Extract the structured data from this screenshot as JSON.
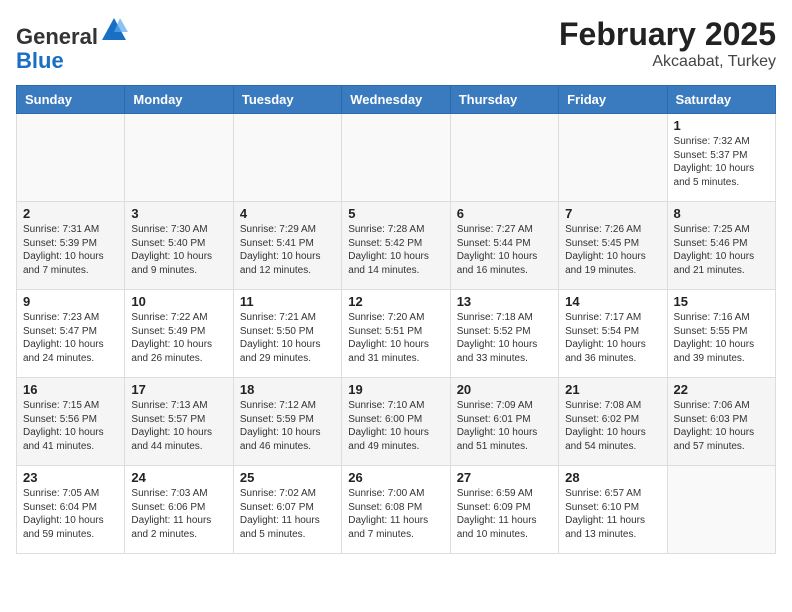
{
  "logo": {
    "general": "General",
    "blue": "Blue"
  },
  "title": "February 2025",
  "subtitle": "Akcaabat, Turkey",
  "days_of_week": [
    "Sunday",
    "Monday",
    "Tuesday",
    "Wednesday",
    "Thursday",
    "Friday",
    "Saturday"
  ],
  "weeks": [
    [
      {
        "day": "",
        "info": ""
      },
      {
        "day": "",
        "info": ""
      },
      {
        "day": "",
        "info": ""
      },
      {
        "day": "",
        "info": ""
      },
      {
        "day": "",
        "info": ""
      },
      {
        "day": "",
        "info": ""
      },
      {
        "day": "1",
        "info": "Sunrise: 7:32 AM\nSunset: 5:37 PM\nDaylight: 10 hours and 5 minutes."
      }
    ],
    [
      {
        "day": "2",
        "info": "Sunrise: 7:31 AM\nSunset: 5:39 PM\nDaylight: 10 hours and 7 minutes."
      },
      {
        "day": "3",
        "info": "Sunrise: 7:30 AM\nSunset: 5:40 PM\nDaylight: 10 hours and 9 minutes."
      },
      {
        "day": "4",
        "info": "Sunrise: 7:29 AM\nSunset: 5:41 PM\nDaylight: 10 hours and 12 minutes."
      },
      {
        "day": "5",
        "info": "Sunrise: 7:28 AM\nSunset: 5:42 PM\nDaylight: 10 hours and 14 minutes."
      },
      {
        "day": "6",
        "info": "Sunrise: 7:27 AM\nSunset: 5:44 PM\nDaylight: 10 hours and 16 minutes."
      },
      {
        "day": "7",
        "info": "Sunrise: 7:26 AM\nSunset: 5:45 PM\nDaylight: 10 hours and 19 minutes."
      },
      {
        "day": "8",
        "info": "Sunrise: 7:25 AM\nSunset: 5:46 PM\nDaylight: 10 hours and 21 minutes."
      }
    ],
    [
      {
        "day": "9",
        "info": "Sunrise: 7:23 AM\nSunset: 5:47 PM\nDaylight: 10 hours and 24 minutes."
      },
      {
        "day": "10",
        "info": "Sunrise: 7:22 AM\nSunset: 5:49 PM\nDaylight: 10 hours and 26 minutes."
      },
      {
        "day": "11",
        "info": "Sunrise: 7:21 AM\nSunset: 5:50 PM\nDaylight: 10 hours and 29 minutes."
      },
      {
        "day": "12",
        "info": "Sunrise: 7:20 AM\nSunset: 5:51 PM\nDaylight: 10 hours and 31 minutes."
      },
      {
        "day": "13",
        "info": "Sunrise: 7:18 AM\nSunset: 5:52 PM\nDaylight: 10 hours and 33 minutes."
      },
      {
        "day": "14",
        "info": "Sunrise: 7:17 AM\nSunset: 5:54 PM\nDaylight: 10 hours and 36 minutes."
      },
      {
        "day": "15",
        "info": "Sunrise: 7:16 AM\nSunset: 5:55 PM\nDaylight: 10 hours and 39 minutes."
      }
    ],
    [
      {
        "day": "16",
        "info": "Sunrise: 7:15 AM\nSunset: 5:56 PM\nDaylight: 10 hours and 41 minutes."
      },
      {
        "day": "17",
        "info": "Sunrise: 7:13 AM\nSunset: 5:57 PM\nDaylight: 10 hours and 44 minutes."
      },
      {
        "day": "18",
        "info": "Sunrise: 7:12 AM\nSunset: 5:59 PM\nDaylight: 10 hours and 46 minutes."
      },
      {
        "day": "19",
        "info": "Sunrise: 7:10 AM\nSunset: 6:00 PM\nDaylight: 10 hours and 49 minutes."
      },
      {
        "day": "20",
        "info": "Sunrise: 7:09 AM\nSunset: 6:01 PM\nDaylight: 10 hours and 51 minutes."
      },
      {
        "day": "21",
        "info": "Sunrise: 7:08 AM\nSunset: 6:02 PM\nDaylight: 10 hours and 54 minutes."
      },
      {
        "day": "22",
        "info": "Sunrise: 7:06 AM\nSunset: 6:03 PM\nDaylight: 10 hours and 57 minutes."
      }
    ],
    [
      {
        "day": "23",
        "info": "Sunrise: 7:05 AM\nSunset: 6:04 PM\nDaylight: 10 hours and 59 minutes."
      },
      {
        "day": "24",
        "info": "Sunrise: 7:03 AM\nSunset: 6:06 PM\nDaylight: 11 hours and 2 minutes."
      },
      {
        "day": "25",
        "info": "Sunrise: 7:02 AM\nSunset: 6:07 PM\nDaylight: 11 hours and 5 minutes."
      },
      {
        "day": "26",
        "info": "Sunrise: 7:00 AM\nSunset: 6:08 PM\nDaylight: 11 hours and 7 minutes."
      },
      {
        "day": "27",
        "info": "Sunrise: 6:59 AM\nSunset: 6:09 PM\nDaylight: 11 hours and 10 minutes."
      },
      {
        "day": "28",
        "info": "Sunrise: 6:57 AM\nSunset: 6:10 PM\nDaylight: 11 hours and 13 minutes."
      },
      {
        "day": "",
        "info": ""
      }
    ]
  ]
}
